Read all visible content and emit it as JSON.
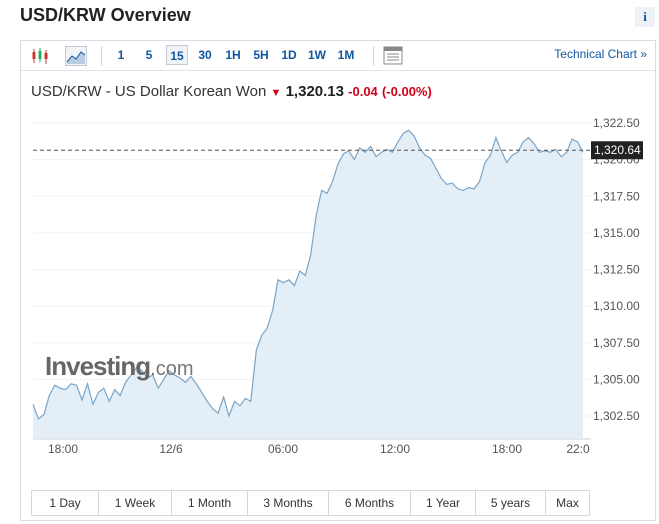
{
  "header": {
    "title": "USD/KRW Overview",
    "info_glyph": "i"
  },
  "toolbar": {
    "intervals": [
      "1",
      "5",
      "15",
      "30",
      "1H",
      "5H",
      "1D",
      "1W",
      "1M"
    ],
    "active_interval": "15",
    "technical_chart_label": "Technical Chart »"
  },
  "quote": {
    "name": "USD/KRW - US Dollar Korean Won",
    "direction_glyph": "▼",
    "price": "1,320.13",
    "change": "-0.04",
    "change_pct": "(-0.00%)"
  },
  "watermark": {
    "brand": "Investing",
    "domain": ".com"
  },
  "ranges": [
    "1 Day",
    "1 Week",
    "1 Month",
    "3 Months",
    "6 Months",
    "1 Year",
    "5 years",
    "Max"
  ],
  "colors": {
    "line": "#7aa5c7",
    "fill": "#e4eef7",
    "accent": "#1256a0",
    "negative": "#d0021b"
  },
  "chart_data": {
    "type": "area",
    "x_ticks": [
      "18:00",
      "12/6",
      "06:00",
      "12:00",
      "18:00",
      "22:0"
    ],
    "y_ticks": [
      "1,322.50",
      "1,320.00",
      "1,317.50",
      "1,315.00",
      "1,312.50",
      "1,310.00",
      "1,307.50",
      "1,305.00",
      "1,302.50"
    ],
    "ylim": [
      1301.5,
      1323.0
    ],
    "current_value": 1320.64,
    "current_label": "1,320.64",
    "y": [
      1303.3,
      1302.3,
      1302.6,
      1303.9,
      1304.6,
      1304.4,
      1304.3,
      1304.7,
      1304.6,
      1303.6,
      1304.7,
      1303.3,
      1304.1,
      1304.4,
      1303.5,
      1304.3,
      1303.9,
      1304.8,
      1305.3,
      1305.8,
      1305.6,
      1305.1,
      1305.3,
      1304.4,
      1305.0,
      1305.6,
      1305.3,
      1305.1,
      1304.8,
      1305.2,
      1304.7,
      1304.1,
      1303.5,
      1303.0,
      1302.7,
      1303.8,
      1302.5,
      1303.5,
      1303.2,
      1303.7,
      1303.5,
      1307.0,
      1308.0,
      1308.5,
      1309.7,
      1311.8,
      1311.6,
      1311.8,
      1311.4,
      1312.4,
      1312.1,
      1313.5,
      1316.2,
      1317.9,
      1317.7,
      1318.5,
      1319.7,
      1320.4,
      1320.6,
      1320.0,
      1320.8,
      1320.5,
      1320.9,
      1320.2,
      1320.5,
      1320.7,
      1320.5,
      1321.2,
      1321.8,
      1322.0,
      1321.6,
      1320.8,
      1320.3,
      1320.1,
      1319.4,
      1318.7,
      1318.3,
      1318.4,
      1318.0,
      1317.9,
      1318.1,
      1318.0,
      1318.5,
      1319.8,
      1320.3,
      1321.5,
      1320.6,
      1319.8,
      1320.3,
      1320.5,
      1321.2,
      1321.5,
      1321.1,
      1320.5,
      1320.6,
      1320.5,
      1320.7,
      1320.2,
      1320.5,
      1321.4,
      1321.2,
      1320.5
    ]
  }
}
